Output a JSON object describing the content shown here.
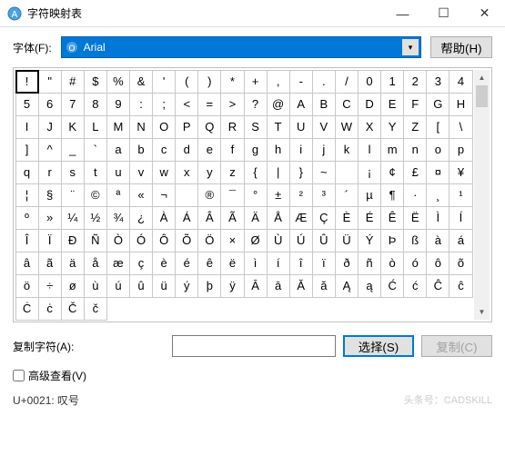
{
  "window": {
    "title": "字符映射表",
    "minimize_icon": "—",
    "maximize_icon": "☐",
    "close_icon": "✕"
  },
  "toolbar": {
    "font_label": "字体(F):",
    "font_value": "Arial",
    "help_label": "帮助(H)"
  },
  "chart_data": {
    "type": "table",
    "title": "Character grid",
    "columns": 20,
    "selected_index": 0,
    "cells": [
      "!",
      "\"",
      "#",
      "$",
      "%",
      "&",
      "'",
      "(",
      ")",
      "*",
      "+",
      ",",
      "-",
      ".",
      "/",
      "0",
      "1",
      "2",
      "3",
      "4",
      "5",
      "6",
      "7",
      "8",
      "9",
      ":",
      ";",
      "<",
      "=",
      ">",
      "?",
      "@",
      "A",
      "B",
      "C",
      "D",
      "E",
      "F",
      "G",
      "H",
      "I",
      "J",
      "K",
      "L",
      "M",
      "N",
      "O",
      "P",
      "Q",
      "R",
      "S",
      "T",
      "U",
      "V",
      "W",
      "X",
      "Y",
      "Z",
      "[",
      "\\",
      "]",
      "^",
      "_",
      "`",
      "a",
      "b",
      "c",
      "d",
      "e",
      "f",
      "g",
      "h",
      "i",
      "j",
      "k",
      "l",
      "m",
      "n",
      "o",
      "p",
      "q",
      "r",
      "s",
      "t",
      "u",
      "v",
      "w",
      "x",
      "y",
      "z",
      "{",
      "|",
      "}",
      "~",
      "",
      "¡",
      "¢",
      "£",
      "¤",
      "¥",
      "¦",
      "§",
      "¨",
      "©",
      "ª",
      "«",
      "¬",
      "­",
      "®",
      "¯",
      "°",
      "±",
      "²",
      "³",
      "´",
      "µ",
      "¶",
      "·",
      "¸",
      "¹",
      "º",
      "»",
      "¼",
      "½",
      "¾",
      "¿",
      "À",
      "Á",
      "Â",
      "Ã",
      "Ä",
      "Å",
      "Æ",
      "Ç",
      "È",
      "É",
      "Ê",
      "Ë",
      "Ì",
      "Í",
      "Î",
      "Ï",
      "Ð",
      "Ñ",
      "Ò",
      "Ó",
      "Ô",
      "Õ",
      "Ö",
      "×",
      "Ø",
      "Ù",
      "Ú",
      "Û",
      "Ü",
      "Ý",
      "Þ",
      "ß",
      "à",
      "á",
      "â",
      "ã",
      "ä",
      "å",
      "æ",
      "ç",
      "è",
      "é",
      "ê",
      "ë",
      "ì",
      "í",
      "î",
      "ï",
      "ð",
      "ñ",
      "ò",
      "ó",
      "ô",
      "õ",
      "ö",
      "÷",
      "ø",
      "ù",
      "ú",
      "û",
      "ü",
      "ý",
      "þ",
      "ÿ",
      "Ā",
      "ā",
      "Ă",
      "ă",
      "Ą",
      "ą",
      "Ć",
      "ć",
      "Ĉ",
      "ĉ",
      "Ċ",
      "ċ",
      "Č",
      "č"
    ]
  },
  "copy": {
    "label": "复制字符(A):",
    "input_value": "",
    "select_label": "选择(S)",
    "copy_label": "复制(C)"
  },
  "advanced": {
    "label": "高级查看(V)"
  },
  "status": {
    "text": "U+0021: 叹号"
  },
  "watermark": "头条号：CADSKILL"
}
